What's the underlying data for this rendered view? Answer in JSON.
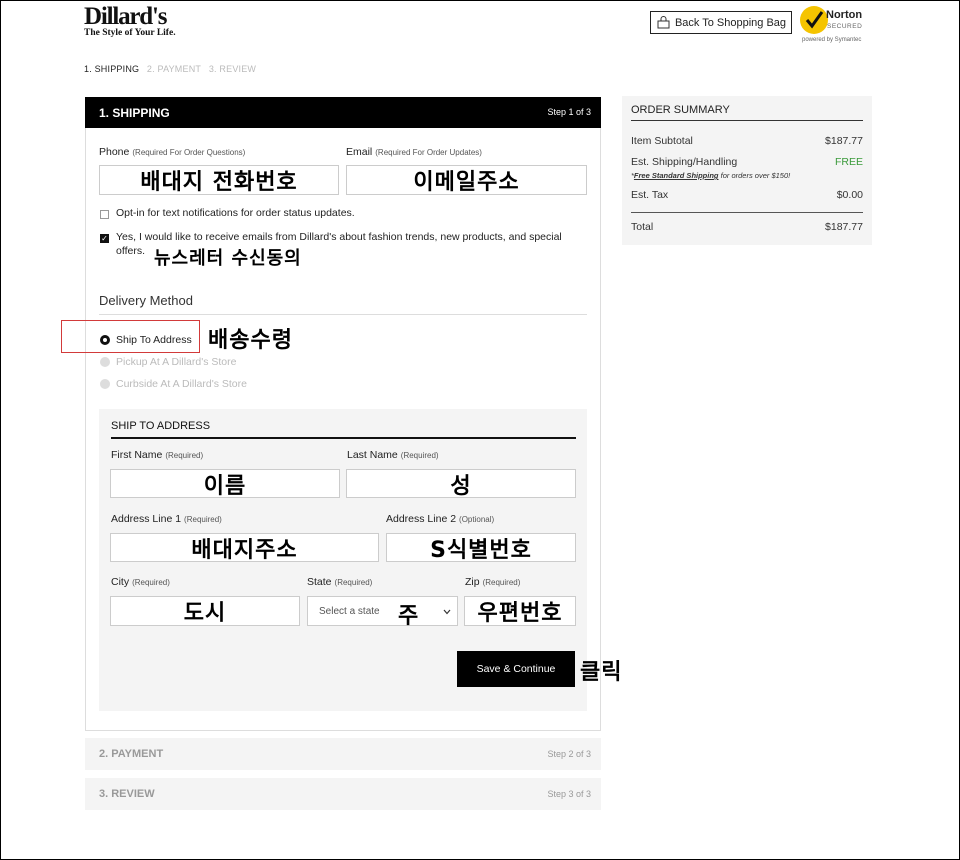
{
  "header": {
    "logo_name": "Dillard's",
    "logo_tagline": "The Style of Your Life.",
    "back_button": "Back To Shopping Bag",
    "norton_name": "Norton",
    "norton_secured": "SECURED",
    "norton_powered": "powered by Symantec"
  },
  "steps": [
    "1. SHIPPING",
    "2. PAYMENT",
    "3. REVIEW"
  ],
  "shipping": {
    "title": "1. SHIPPING",
    "step": "Step 1 of 3",
    "phone_label": "Phone",
    "phone_req": "(Required For Order Questions)",
    "phone_value": "배대지 전화번호",
    "email_label": "Email",
    "email_req": "(Required For Order Updates)",
    "email_value": "이메일주소",
    "optin_text": "Opt-in for text notifications for order status updates.",
    "newsletter_text": "Yes, I would like to receive emails from Dillard's about fashion trends, new products, and special offers.",
    "newsletter_note": "뉴스레터 수신동의",
    "delivery_title": "Delivery Method",
    "delivery_options": [
      "Ship To Address",
      "Pickup At A Dillard's Store",
      "Curbside At A Dillard's Store"
    ],
    "delivery_note": "배송수령",
    "address_title": "SHIP TO ADDRESS",
    "first_name_label": "First Name",
    "first_name_req": "(Required)",
    "first_name_value": "이름",
    "last_name_label": "Last Name",
    "last_name_req": "(Required)",
    "last_name_value": "성",
    "addr1_label": "Address Line 1",
    "addr1_req": "(Required)",
    "addr1_value": "배대지주소",
    "addr2_label": "Address Line 2",
    "addr2_req": "(Optional)",
    "addr2_value": "S식별번호",
    "city_label": "City",
    "city_req": "(Required)",
    "city_value": "도시",
    "state_label": "State",
    "state_req": "(Required)",
    "state_placeholder": "Select a state",
    "state_note": "주",
    "zip_label": "Zip",
    "zip_req": "(Required)",
    "zip_value": "우편번호",
    "save_button": "Save & Continue",
    "save_note": "클릭"
  },
  "payment": {
    "title": "2. PAYMENT",
    "step": "Step 2 of 3"
  },
  "review": {
    "title": "3. REVIEW",
    "step": "Step 3 of 3"
  },
  "summary": {
    "title": "ORDER SUMMARY",
    "subtotal_label": "Item Subtotal",
    "subtotal_value": "$187.77",
    "shipping_label": "Est. Shipping/Handling",
    "shipping_value": "FREE",
    "shipping_note_link": "Free Standard Shipping",
    "shipping_note_text": "for orders over $150!",
    "tax_label": "Est. Tax",
    "tax_value": "$0.00",
    "total_label": "Total",
    "total_value": "$187.77"
  },
  "colors": {
    "free_green": "#3a9a3a",
    "highlight_red": "#d23a3a",
    "header_black": "#000000"
  }
}
